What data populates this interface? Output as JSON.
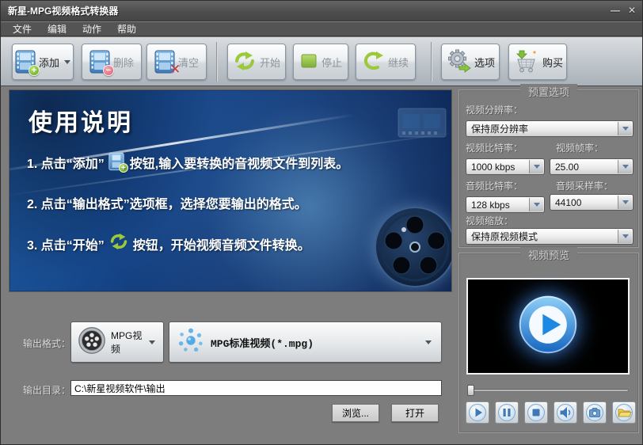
{
  "window": {
    "title": "新星-MPG视频格式转换器",
    "minimize_glyph": "—",
    "close_glyph": "✕"
  },
  "menu": {
    "items": [
      "文件",
      "编辑",
      "动作",
      "帮助"
    ]
  },
  "toolbar": {
    "add": "添加",
    "remove": "删除",
    "clear": "清空",
    "start": "开始",
    "stop": "停止",
    "resume": "继续",
    "options": "选项",
    "buy": "购买"
  },
  "icons": {
    "add_badge": "+",
    "remove_badge": "−",
    "clear_badge": "✕"
  },
  "banner": {
    "title": "使用说明",
    "step1_pre": "1. 点击“添加”",
    "step1_post": "按钮,输入要转换的音视频文件到列表。",
    "step2": "2. 点击“输出格式”选项框，选择您要输出的格式。",
    "step3_pre": "3. 点击“开始”",
    "step3_post": "按钮，开始视频音频文件转换。"
  },
  "presets": {
    "title": "预置选项",
    "resolution_label": "视频分辨率：",
    "resolution_value": "保持原分辨率",
    "video_bitrate_label": "视频比特率：",
    "video_bitrate_value": "1000 kbps",
    "frame_rate_label": "视频帧率：",
    "frame_rate_value": "25.00",
    "audio_bitrate_label": "音频比特率：",
    "audio_bitrate_value": "128 kbps",
    "sample_rate_label": "音频采样率：",
    "sample_rate_value": "44100",
    "scale_label": "视频缩放：",
    "scale_value": "保持原视频模式"
  },
  "preview": {
    "title": "视频预览"
  },
  "output": {
    "format_label": "输出格式：",
    "category_value": "MPG视频",
    "profile_value": "MPG标准视频(*.mpg)",
    "dir_label": "输出目录：",
    "dir_value": "C:\\新星视频软件\\输出",
    "browse_label": "浏览...",
    "open_label": "打开"
  },
  "colors": {
    "accent_green": "#9cc83c",
    "banner_blue": "#123c77",
    "player_blue": "#1976d2",
    "chrome_gray": "#7d7d7d"
  }
}
